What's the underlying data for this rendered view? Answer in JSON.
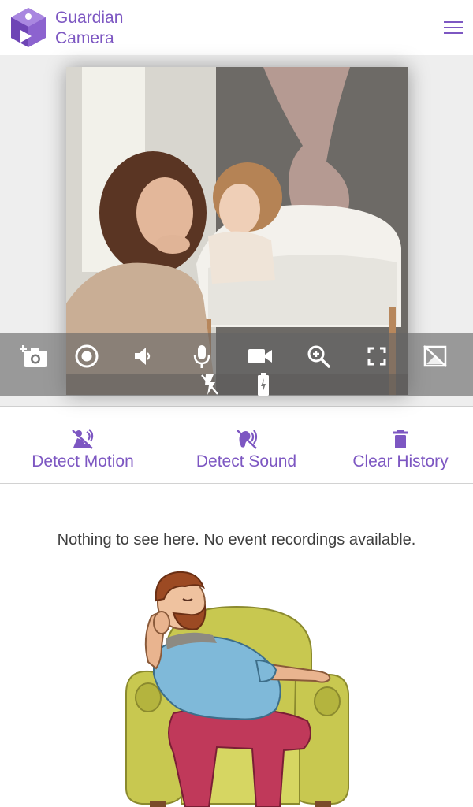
{
  "header": {
    "title_line1": "Guardian",
    "title_line2": "Camera",
    "logo_icon": "cube-logo-icon",
    "menu_icon": "hamburger-menu-icon"
  },
  "camera": {
    "controls_row1": [
      "add-photo-icon",
      "record-icon",
      "volume-icon",
      "microphone-icon",
      "video-camera-icon",
      "zoom-in-icon",
      "fullscreen-icon",
      "hide-video-icon"
    ],
    "controls_row2": [
      "flash-off-icon",
      "battery-charging-icon"
    ]
  },
  "actions": {
    "detect_motion": "Detect Motion",
    "detect_sound": "Detect Sound",
    "clear_history": "Clear History"
  },
  "events": {
    "empty_message": "Nothing to see here. No event recordings available."
  },
  "colors": {
    "accent": "#7d57c2",
    "controls_overlay": "#646464",
    "armchair": "#c8c850",
    "shirt": "#7fb9d9",
    "pants": "#c0395a"
  }
}
